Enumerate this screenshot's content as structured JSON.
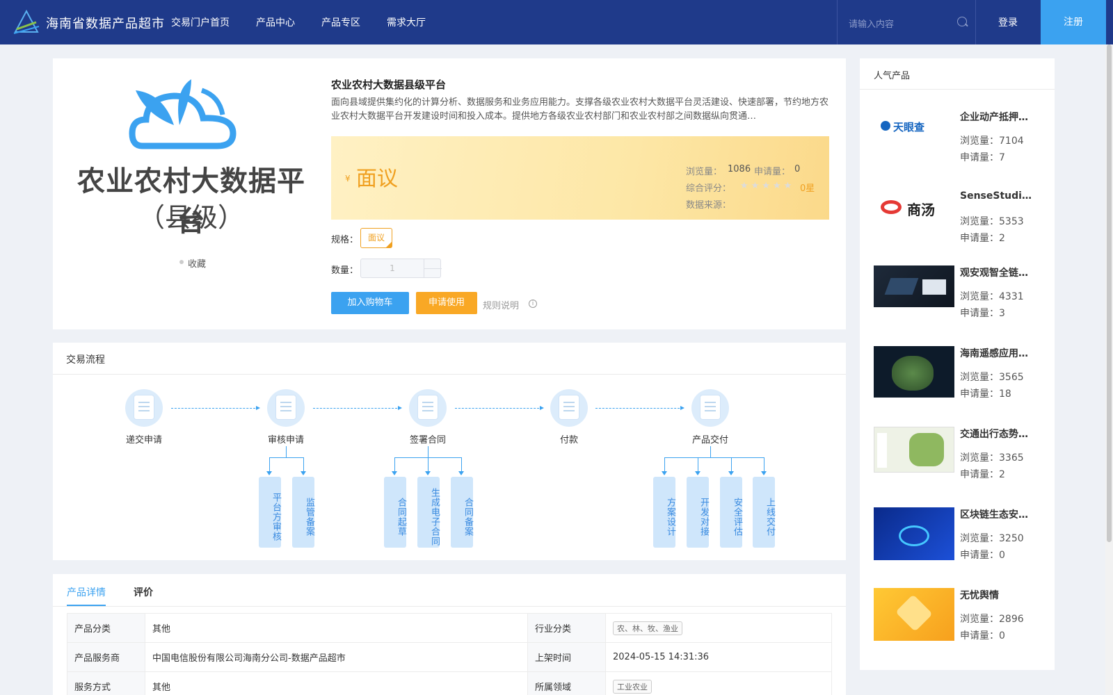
{
  "header": {
    "brand": "海南省数据产品超市",
    "nav": [
      "交易门户首页",
      "产品中心",
      "产品专区",
      "需求大厅"
    ],
    "search_placeholder": "请输入内容",
    "login": "登录",
    "register": "注册"
  },
  "product": {
    "title": "农业农村大数据县级平台",
    "description": "面向县域提供集约化的计算分析、数据服务和业务应用能力。支撑各级农业农村大数据平台灵活建设、快速部署，节约地方农业农村大数据平台开发建设时间和投入成本。提供地方各级农业农村部门和农业农村部之间数据纵向贯通…",
    "image_line1": "农业农村大数据平台",
    "image_line2": "（县级）",
    "favorite": "收藏",
    "price_symbol": "¥",
    "price": "面议",
    "views_label": "浏览量：",
    "views": "1086",
    "apply_label": "申请量：",
    "apply": "0",
    "rating_label": "综合评分：",
    "rating_stars": "★★★★★",
    "rating_value": "0星",
    "source_label": "数据来源：",
    "spec_label": "规格：",
    "spec_value": "面议",
    "qty_label": "数量：",
    "qty_value": "1",
    "add_cart": "加入购物车",
    "apply_use": "申请使用",
    "rules": "规则说明"
  },
  "process": {
    "title": "交易流程",
    "steps": [
      "递交申请",
      "审核申请",
      "签署合同",
      "付款",
      "产品交付"
    ],
    "sub_review": [
      "平台方审核",
      "监管备案"
    ],
    "sub_contract": [
      "合同起草",
      "生成电子合同",
      "合同备案"
    ],
    "sub_delivery": [
      "方案设计",
      "开发对接",
      "安全评估",
      "上线交付"
    ]
  },
  "tabs": [
    "产品详情",
    "评价"
  ],
  "details": {
    "category_label": "产品分类",
    "category": "其他",
    "industry_label": "行业分类",
    "industry": "农、林、牧、渔业",
    "provider_label": "产品服务商",
    "provider": "中国电信股份有限公司海南分公司-数据产品超市",
    "listed_label": "上架时间",
    "listed": "2024-05-15 14:31:36",
    "service_label": "服务方式",
    "service": "其他",
    "domain_label": "所属领域",
    "domain": "工业农业"
  },
  "popular": {
    "title": "人气产品",
    "view_label": "浏览量：",
    "apply_label": "申请量：",
    "items": [
      {
        "name": "企业动产抵押…",
        "views": "7104",
        "apply": "7",
        "thumb_text": "天眼查"
      },
      {
        "name": "SenseStudio…",
        "views": "5353",
        "apply": "2",
        "thumb_text": "商汤"
      },
      {
        "name": "观安观智全链…",
        "views": "4331",
        "apply": "3",
        "thumb_text": ""
      },
      {
        "name": "海南遥感应用…",
        "views": "3565",
        "apply": "18",
        "thumb_text": ""
      },
      {
        "name": "交通出行态势…",
        "views": "3365",
        "apply": "2",
        "thumb_text": ""
      },
      {
        "name": "区块链生态安…",
        "views": "3250",
        "apply": "0",
        "thumb_text": ""
      },
      {
        "name": "无忧舆情",
        "views": "2896",
        "apply": "0",
        "thumb_text": ""
      }
    ]
  },
  "colors": {
    "header": "#1f3a8a",
    "accent": "#3ba2f0",
    "orange": "#f9a825"
  }
}
